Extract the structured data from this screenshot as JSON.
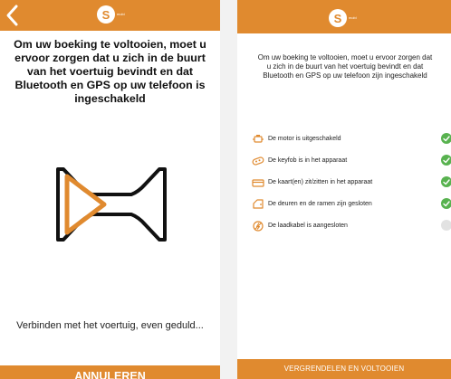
{
  "left_screen": {
    "logo": {
      "letter": "S",
      "word": "mobi"
    },
    "message": "Om uw boeking te voltooien, moet u ervoor zorgen dat u zich in de buurt van het voertuig bevindt en dat Bluetooth en GPS op uw telefoon is ingeschakeld",
    "status": "Verbinden met het voertuig, even geduld...",
    "cancel_label": "ANNULEREN"
  },
  "right_screen": {
    "logo": {
      "letter": "S",
      "word": "mobi"
    },
    "message": "Om uw boeking te voltooien, moet u ervoor zorgen dat u zich in de buurt van het voertuig bevindt en dat Bluetooth en GPS op uw telefoon zijn ingeschakeld",
    "checklist": [
      {
        "icon": "engine-icon",
        "label": "De motor is uitgeschakeld",
        "status": "ok"
      },
      {
        "icon": "keyfob-icon",
        "label": "De keyfob is in het apparaat",
        "status": "ok"
      },
      {
        "icon": "card-icon",
        "label": "De kaart(en) zit/zitten in het apparaat",
        "status": "ok"
      },
      {
        "icon": "door-icon",
        "label": "De deuren en de ramen zijn gesloten",
        "status": "ok"
      },
      {
        "icon": "charging-cable-icon",
        "label": "De laadkabel is aangesloten",
        "status": "pending"
      }
    ],
    "lock_label": "VERGRENDELEN EN VOLTOOIEN"
  },
  "colors": {
    "accent": "#e08a2f",
    "ok": "#58b24f",
    "pending": "#e2e2e2"
  }
}
